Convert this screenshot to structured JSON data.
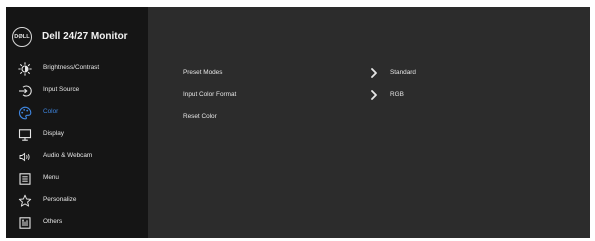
{
  "header": {
    "logo_text": "DØLL",
    "title": "Dell 24/27 Monitor"
  },
  "sidebar": {
    "items": [
      {
        "label": "Brightness/Contrast",
        "icon": "brightness-icon",
        "active": false
      },
      {
        "label": "Input Source",
        "icon": "input-source-icon",
        "active": false
      },
      {
        "label": "Color",
        "icon": "color-palette-icon",
        "active": true
      },
      {
        "label": "Display",
        "icon": "display-icon",
        "active": false
      },
      {
        "label": "Audio & Webcam",
        "icon": "speaker-icon",
        "active": false
      },
      {
        "label": "Menu",
        "icon": "menu-icon",
        "active": false
      },
      {
        "label": "Personalize",
        "icon": "star-icon",
        "active": false
      },
      {
        "label": "Others",
        "icon": "others-icon",
        "active": false
      }
    ]
  },
  "panel": {
    "rows": [
      {
        "label": "Preset Modes",
        "value": "Standard",
        "has_submenu": true
      },
      {
        "label": "Input Color Format",
        "value": "RGB",
        "has_submenu": true
      },
      {
        "label": "Reset Color",
        "value": "",
        "has_submenu": false
      }
    ]
  },
  "colors": {
    "sidebar_bg": "#151515",
    "panel_bg": "#2c2c2c",
    "text": "#e6e6e6",
    "accent": "#3f86e0"
  }
}
